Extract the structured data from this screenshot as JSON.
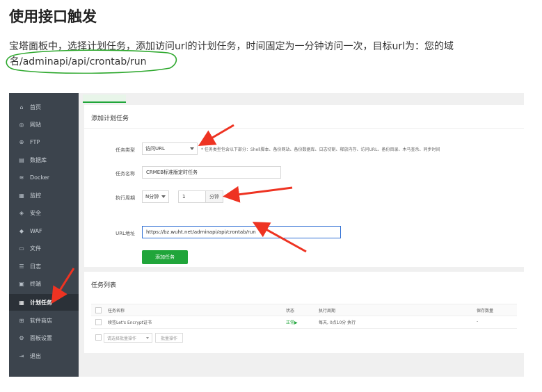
{
  "doc": {
    "title": "使用接口触发",
    "paragraph": "宝塔面板中，选择计划任务，添加访问url的计划任务，时间固定为一分钟访问一次，目标url为：您的域",
    "url_line": "名/adminapi/api/crontab/run"
  },
  "colors": {
    "accent": "#20a53a",
    "sidebar_bg": "#3c444d",
    "annotation_red": "#ee3322",
    "annotation_green": "#2ea82e"
  },
  "sidebar": {
    "items": [
      {
        "label": "首页",
        "icon": "home-icon",
        "glyph": "⌂"
      },
      {
        "label": "网站",
        "icon": "globe-icon",
        "glyph": "◎"
      },
      {
        "label": "FTP",
        "icon": "ftp-icon",
        "glyph": "⊕"
      },
      {
        "label": "数据库",
        "icon": "database-icon",
        "glyph": "▤"
      },
      {
        "label": "Docker",
        "icon": "docker-icon",
        "glyph": "≋"
      },
      {
        "label": "监控",
        "icon": "monitor-icon",
        "glyph": "▦"
      },
      {
        "label": "安全",
        "icon": "shield-icon",
        "glyph": "◈"
      },
      {
        "label": "WAF",
        "icon": "waf-icon",
        "glyph": "◆"
      },
      {
        "label": "文件",
        "icon": "folder-icon",
        "glyph": "▭"
      },
      {
        "label": "日志",
        "icon": "log-icon",
        "glyph": "☰"
      },
      {
        "label": "终端",
        "icon": "terminal-icon",
        "glyph": "▣"
      },
      {
        "label": "计划任务",
        "icon": "calendar-icon",
        "glyph": "▦",
        "active": true
      },
      {
        "label": "软件商店",
        "icon": "store-icon",
        "glyph": "⊞"
      },
      {
        "label": "面板设置",
        "icon": "settings-icon",
        "glyph": "⚙"
      },
      {
        "label": "退出",
        "icon": "logout-icon",
        "glyph": "⇥"
      }
    ]
  },
  "form": {
    "heading": "添加计划任务",
    "task_type_label": "任务类型",
    "task_type_value": "访问URL",
    "task_type_tip": "* 任务类型包含以下部分：Shell脚本、备份网站、备份数据库、日志切割、释放内存、访问URL、备份目录、木马查杀、同步时间",
    "task_name_label": "任务名称",
    "task_name_value": "CRMEB标准版定时任务",
    "period_label": "执行周期",
    "period_value": "N分钟",
    "period_number": "1",
    "period_unit": "分钟",
    "url_label": "URL地址",
    "url_value": "https://bz.wuht.net/adminapi/api/crontab/run",
    "add_button": "添加任务"
  },
  "task_list": {
    "title": "任务列表",
    "columns": [
      "任务名称",
      "状态",
      "执行周期",
      "保存数量"
    ],
    "rows": [
      {
        "name": "续签Let's Encrypt证书",
        "status": "正常▶",
        "period": "每天, 0点10分 执行",
        "keep": "-"
      }
    ],
    "batch_placeholder": "请选择批量操作",
    "batch_button": "批量操作"
  }
}
